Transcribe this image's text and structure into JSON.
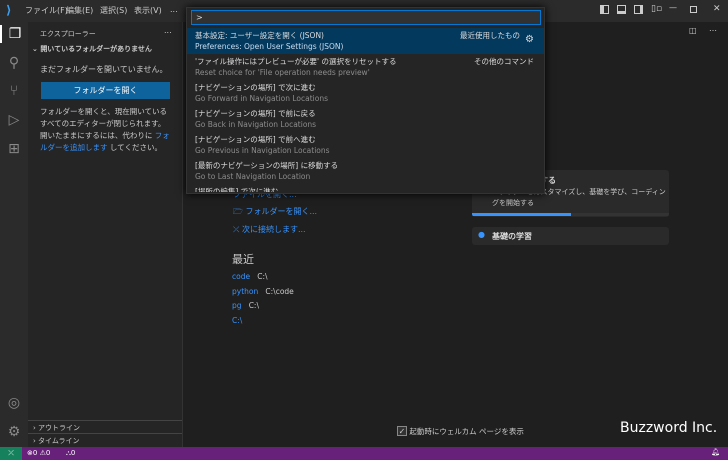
{
  "menu": [
    "ファイル(F)",
    "編集(E)",
    "選択(S)",
    "表示(V)",
    "..."
  ],
  "sidebar": {
    "title": "エクスプローラー",
    "more": "...",
    "section": "開いているフォルダーがありません",
    "no_folder": "まだフォルダーを開いていません。",
    "open_folder_button": "フォルダーを開く",
    "desc1": "フォルダーを開くと、現在開いているすべてのエディターが閉じられます。開いたままにするには、代わりに",
    "desc_link": "フォルダーを追加します",
    "desc2": "してください。",
    "outline": "アウトライン",
    "timeline": "タイムライン"
  },
  "palette": {
    "input": ">",
    "items": [
      {
        "label": "基本設定: ユーザー設定を開く (JSON)",
        "detail": "Preferences: Open User Settings (JSON)",
        "tag": "最近使用したもの"
      },
      {
        "label": "'ファイル操作にはプレビューが必要' の選択をリセットする",
        "detail": "Reset choice for 'File operation needs preview'",
        "tag": "その他のコマンド"
      },
      {
        "label": "[ナビゲーションの場所] で次に進む",
        "detail": "Go Forward in Navigation Locations"
      },
      {
        "label": "[ナビゲーションの場所] で前に戻る",
        "detail": "Go Back in Navigation Locations"
      },
      {
        "label": "[ナビゲーションの場所] で前へ進む",
        "detail": "Go Previous in Navigation Locations"
      },
      {
        "label": "[最新のナビゲーションの場所] に移動する",
        "detail": "Go to Last Navigation Location"
      },
      {
        "label": "[場所の編集] で次に進む"
      }
    ]
  },
  "welcome": {
    "open_file": "ファイルを開く...",
    "open_folder": "フォルダーを開く...",
    "connect": "次に接続します...",
    "recent_title": "最近",
    "recent": [
      {
        "name": "code",
        "path": "C:\\"
      },
      {
        "name": "python",
        "path": "C:\\code"
      },
      {
        "name": "pg",
        "path": "C:\\"
      },
      {
        "name": "C:\\",
        "path": ""
      }
    ],
    "walk_title": "合する",
    "walk_desc": "エディターをカスタマイズし、基礎を学び、コーディングを開始する",
    "walk_progress": 0.5,
    "learn": "基礎の学習",
    "show_on_startup": "起動時にウェルカム ページを表示"
  },
  "status": {
    "errors": "0",
    "warnings": "0",
    "ports": "0"
  },
  "watermark": "Buzzword Inc."
}
